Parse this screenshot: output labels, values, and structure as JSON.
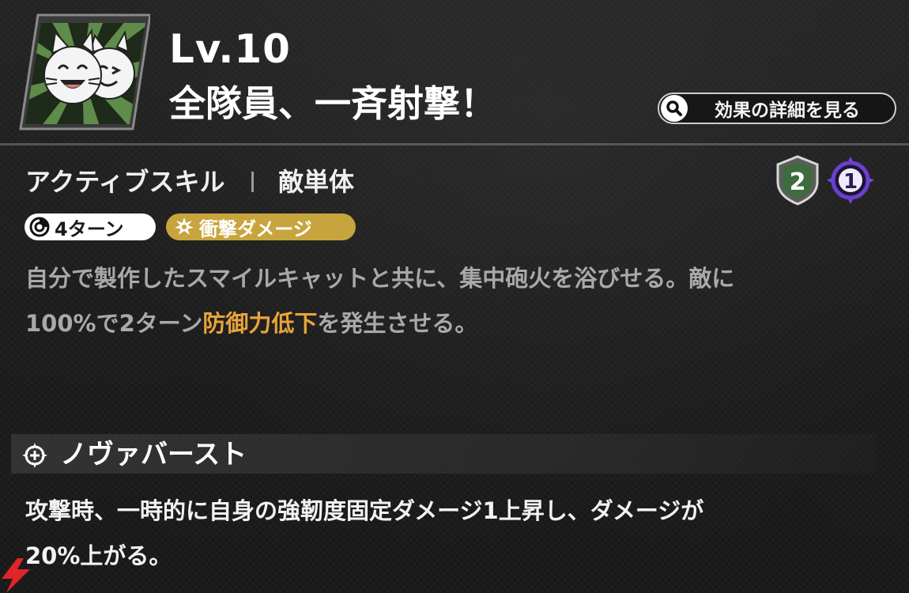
{
  "header": {
    "level": "Lv.10",
    "skill_name": "全隊員、一斉射撃！",
    "detail_button_label": "効果の詳細を見る",
    "icon": "smiling-cats-icon"
  },
  "skill": {
    "type": "アクティブスキル",
    "target": "敵単体",
    "badge_green_value": "2",
    "badge_purple_value": "1",
    "tags": {
      "cooldown": "4ターン",
      "damage_type": "衝撃ダメージ"
    },
    "description": {
      "part1": "自分で製作したスマイルキャットと共に、集中砲火を浴びせる。敵に",
      "part2": "100%で2ターン",
      "highlight": "防御力低下",
      "part3": "を発生させる。"
    }
  },
  "nova_burst": {
    "title": "ノヴァバースト",
    "icon": "nova-burst-icon",
    "description_line1": "攻撃時、一時的に自身の強靭度固定ダメージ1上昇し、ダメージが",
    "description_line2": "20%上がる。"
  },
  "colors": {
    "highlight": "#e8a43a",
    "damage_tag": "#c7a43d",
    "badge_green": "#3e6b3f",
    "badge_purple": "#6a3fd0",
    "icon_green": "#5e8c4a"
  }
}
